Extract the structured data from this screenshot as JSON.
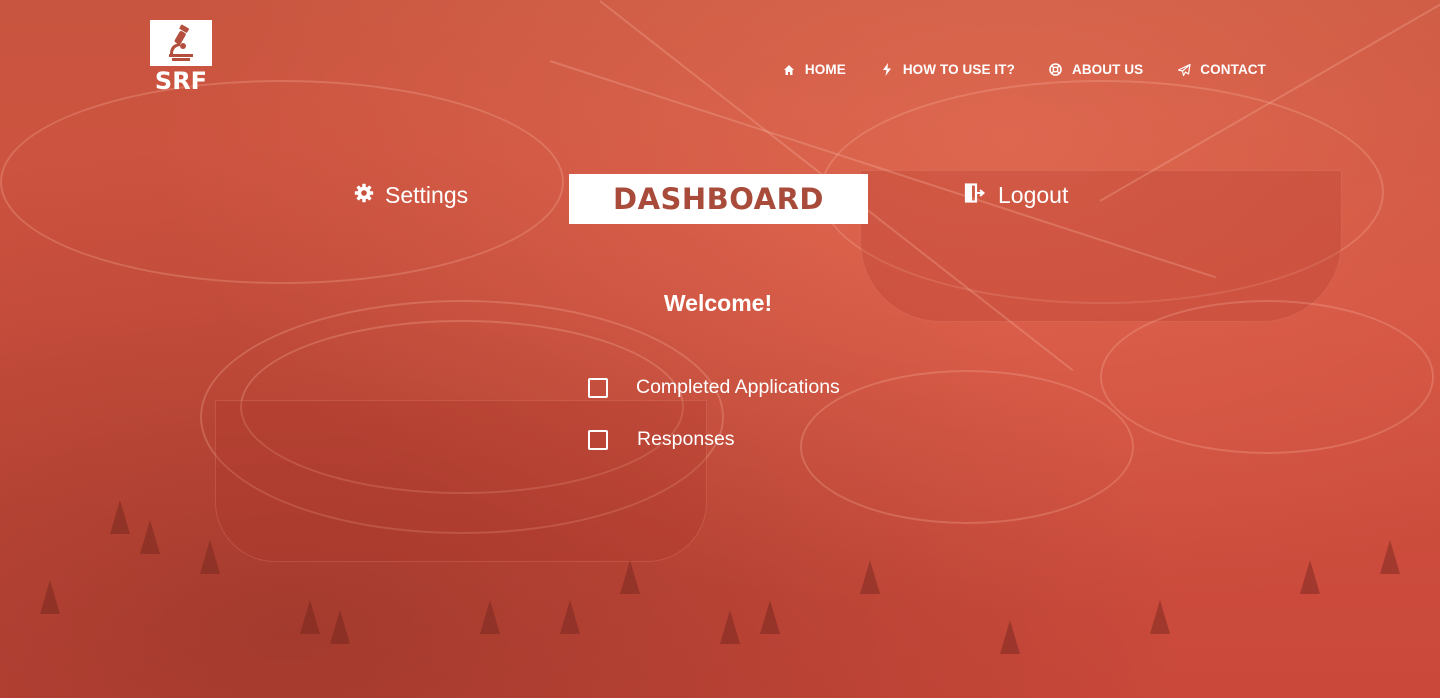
{
  "logo": {
    "text": "SRF",
    "icon": "microscope-icon"
  },
  "nav": {
    "items": [
      {
        "label": "HOME",
        "icon": "home-icon"
      },
      {
        "label": "HOW TO USE IT?",
        "icon": "bolt-icon"
      },
      {
        "label": "ABOUT US",
        "icon": "lifebuoy-icon"
      },
      {
        "label": "CONTACT",
        "icon": "paper-plane-icon"
      }
    ]
  },
  "tabs": {
    "settings": {
      "label": "Settings",
      "icon": "gear-icon"
    },
    "dashboard": {
      "label": "DASHBOARD"
    },
    "logout": {
      "label": "Logout",
      "icon": "exit-icon"
    }
  },
  "main": {
    "welcome": "Welcome!",
    "options": [
      {
        "label": "Completed Applications",
        "checked": false
      },
      {
        "label": "Responses",
        "checked": false
      }
    ]
  },
  "colors": {
    "overlay": "#c9503d",
    "dashboard_text": "#a84b3a",
    "text": "#ffffff"
  }
}
